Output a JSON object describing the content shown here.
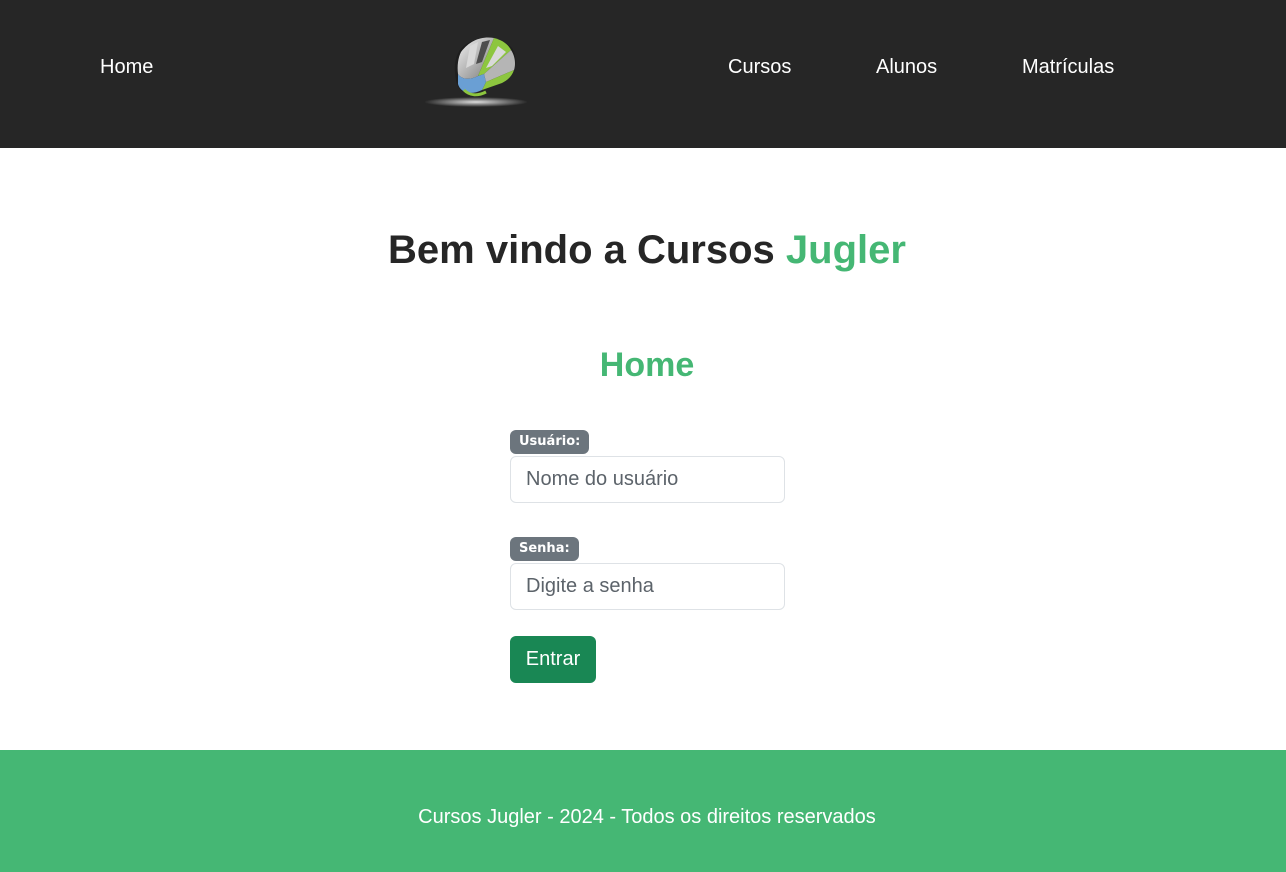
{
  "nav": {
    "home": "Home",
    "cursos": "Cursos",
    "alunos": "Alunos",
    "matriculas": "Matrículas",
    "logo_icon": "globe-logo-icon"
  },
  "welcome": {
    "prefix": "Bem vindo a Cursos ",
    "brand": "Jugler"
  },
  "page_title": "Home",
  "form": {
    "user_label": "Usuário:",
    "user_placeholder": "Nome do usuário",
    "password_label": "Senha:",
    "password_placeholder": "Digite a senha",
    "submit_label": "Entrar"
  },
  "footer": {
    "text": "Cursos Jugler - 2024 - Todos os direitos reservados"
  },
  "colors": {
    "header_bg": "#262626",
    "accent": "#45b774",
    "button": "#198754",
    "badge": "#6c757d"
  }
}
